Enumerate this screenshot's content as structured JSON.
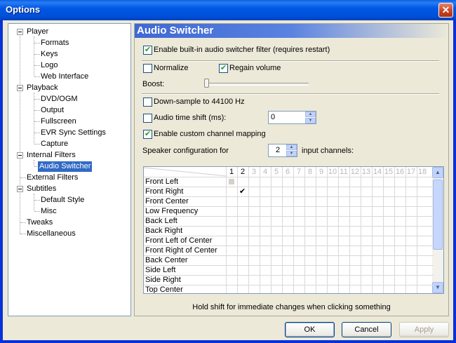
{
  "window": {
    "title": "Options"
  },
  "tree": {
    "items": [
      {
        "label": "Player"
      },
      {
        "label": "Formats"
      },
      {
        "label": "Keys"
      },
      {
        "label": "Logo"
      },
      {
        "label": "Web Interface"
      },
      {
        "label": "Playback"
      },
      {
        "label": "DVD/OGM"
      },
      {
        "label": "Output"
      },
      {
        "label": "Fullscreen"
      },
      {
        "label": "EVR Sync Settings"
      },
      {
        "label": "Capture"
      },
      {
        "label": "Internal Filters"
      },
      {
        "label": "Audio Switcher"
      },
      {
        "label": "External Filters"
      },
      {
        "label": "Subtitles"
      },
      {
        "label": "Default Style"
      },
      {
        "label": "Misc"
      },
      {
        "label": "Tweaks"
      },
      {
        "label": "Miscellaneous"
      }
    ],
    "selected": "Audio Switcher"
  },
  "panel": {
    "title": "Audio Switcher",
    "enable_switcher": {
      "label": "Enable built-in audio switcher filter (requires restart)",
      "checked": true
    },
    "normalize": {
      "label": "Normalize",
      "checked": false
    },
    "regain_volume": {
      "label": "Regain volume",
      "checked": true
    },
    "boost": {
      "label": "Boost:",
      "level": 0
    },
    "downsample": {
      "label": "Down-sample to 44100 Hz",
      "checked": false
    },
    "time_shift": {
      "label": "Audio time shift (ms):",
      "checked": false,
      "value": "0"
    },
    "custom_mapping": {
      "label": "Enable custom channel mapping",
      "checked": true
    },
    "speaker_config": {
      "prefix": "Speaker configuration for",
      "value": "2",
      "suffix": "input channels:"
    },
    "channel_grid": {
      "columns": [
        "1",
        "2",
        "3",
        "4",
        "5",
        "6",
        "7",
        "8",
        "9",
        "10",
        "11",
        "12",
        "13",
        "14",
        "15",
        "16",
        "17",
        "18"
      ],
      "active_columns": 2,
      "rows": [
        "Front Left",
        "Front Right",
        "Front Center",
        "Low Frequency",
        "Back Left",
        "Back Right",
        "Front Left of Center",
        "Front Right of Center",
        "Back Center",
        "Side Left",
        "Side Right",
        "Top Center"
      ],
      "checked": [
        {
          "row": "Front Right",
          "col": "2"
        }
      ]
    },
    "hint": "Hold shift for immediate changes when clicking something"
  },
  "buttons": {
    "ok": "OK",
    "cancel": "Cancel",
    "apply": "Apply"
  }
}
